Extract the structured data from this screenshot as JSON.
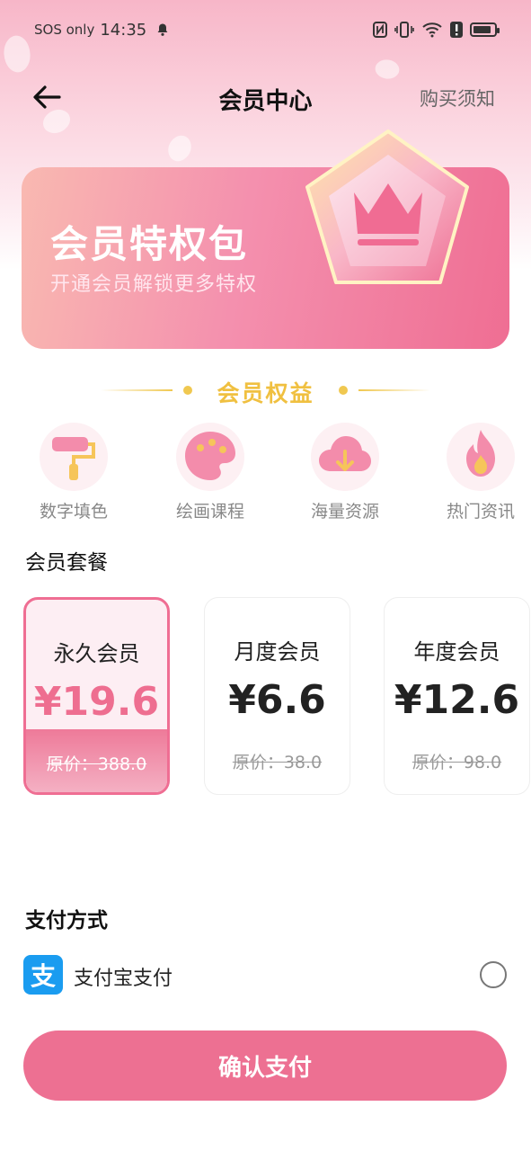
{
  "status_bar": {
    "sos": "SOS only",
    "time": "14:35",
    "battery_level": 0.85
  },
  "header": {
    "title": "会员中心",
    "notice_link": "购买须知"
  },
  "banner": {
    "title": "会员特权包",
    "subtitle": "开通会员解锁更多特权"
  },
  "benefits": {
    "title": "会员权益",
    "items": [
      {
        "label": "数字填色",
        "icon": "paint-roller-icon"
      },
      {
        "label": "绘画课程",
        "icon": "palette-icon"
      },
      {
        "label": "海量资源",
        "icon": "cloud-download-icon"
      },
      {
        "label": "热门资讯",
        "icon": "flame-icon"
      }
    ]
  },
  "plans": {
    "title": "会员套餐",
    "items": [
      {
        "name": "永久会员",
        "price": "¥19.6",
        "original": "原价：388.0",
        "selected": true
      },
      {
        "name": "月度会员",
        "price": "¥6.6",
        "original": "原价：38.0",
        "selected": false
      },
      {
        "name": "年度会员",
        "price": "¥12.6",
        "original": "原价：98.0",
        "selected": false
      }
    ]
  },
  "payment": {
    "title": "支付方式",
    "method_label": "支付宝支付",
    "icon": "alipay-icon"
  },
  "confirm_button": "确认支付",
  "colors": {
    "accent": "#ed7092",
    "gold": "#f0c040",
    "alipay": "#1a9cf0"
  }
}
